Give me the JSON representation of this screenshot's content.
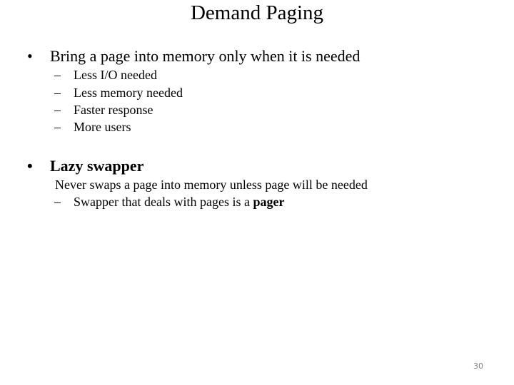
{
  "title": "Demand Paging",
  "bullets": [
    {
      "marker": "•",
      "text": "Bring a page into memory only when it is needed",
      "subitems": [
        {
          "marker": "–",
          "text": "Less I/O needed"
        },
        {
          "marker": "–",
          "text": "Less memory needed"
        },
        {
          "marker": "–",
          "text": "Faster response"
        },
        {
          "marker": "–",
          "text": "More users"
        }
      ]
    },
    {
      "marker": "•",
      "text": "Lazy swapper",
      "note": "Never swaps a page into memory unless page will be needed",
      "subitems": [
        {
          "marker": "–",
          "text": "Swapper that deals with pages is a ",
          "bold_suffix": "pager"
        }
      ]
    }
  ],
  "page_number": "30"
}
